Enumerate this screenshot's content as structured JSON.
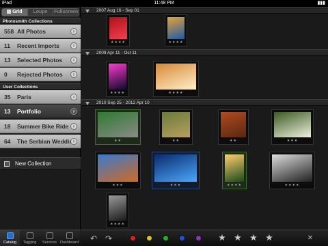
{
  "status_bar": {
    "device": "iPad",
    "wifi": "wifi",
    "time": "11:48 PM",
    "battery": "battery-full"
  },
  "view_switch": {
    "options": [
      "Grid",
      "Loupe",
      "Fullscreen"
    ],
    "selected": "Grid"
  },
  "sidebar": {
    "photosmith_header": "Photosmith Collections",
    "photosmith_items": [
      {
        "count": "558",
        "label": "All Photos"
      },
      {
        "count": "11",
        "label": "Recent Imports"
      },
      {
        "count": "13",
        "label": "Selected Photos"
      },
      {
        "count": "0",
        "label": "Rejected Photos"
      }
    ],
    "user_header": "User Collections",
    "user_items": [
      {
        "count": "35",
        "label": "Paris"
      },
      {
        "count": "13",
        "label": "Portfolio",
        "selected": true
      },
      {
        "count": "18",
        "label": "Summer Bike Ride"
      },
      {
        "count": "64",
        "label": "The Serbian Wedding"
      }
    ],
    "new_collection": "New Collection"
  },
  "sections": [
    {
      "title": "2007 Aug 16 - Sep 01"
    },
    {
      "title": "2009 Apr 11 - Oct 11"
    },
    {
      "title": "2010 Sep 25 - 2012 Apr 10"
    }
  ],
  "thumbs": [
    {
      "name": "photo-red-flowers",
      "stars": "★★★★",
      "colors": [
        "#b0101a",
        "#f04050"
      ]
    },
    {
      "name": "photo-lake-sky",
      "stars": "★★★★",
      "colors": [
        "#e6a23a",
        "#1d5aa8"
      ]
    },
    {
      "name": "photo-light-painting",
      "stars": "★★★★",
      "colors": [
        "#ff3ad1",
        "#0a0a28"
      ]
    },
    {
      "name": "photo-airplane",
      "stars": "★★★★",
      "colors": [
        "#d8883a",
        "#fff0c8"
      ]
    },
    {
      "name": "photo-green-car",
      "stars": "★★",
      "colors": [
        "#2f7a2f",
        "#8a8a8a"
      ]
    },
    {
      "name": "photo-field-birds",
      "stars": "★★",
      "colors": [
        "#6a7a3a",
        "#b8a060"
      ]
    },
    {
      "name": "photo-autumn-grass",
      "stars": "★★",
      "colors": [
        "#b04a20",
        "#5a2810"
      ]
    },
    {
      "name": "photo-white-flowers",
      "stars": "★★★",
      "colors": [
        "#3a5a20",
        "#f0f0e0"
      ]
    },
    {
      "name": "photo-motorcycle",
      "stars": "★★★",
      "colors": [
        "#3a7ad0",
        "#d06a20"
      ]
    },
    {
      "name": "photo-blue-light",
      "stars": "★★★",
      "colors": [
        "#0a2a6a",
        "#4aa8ff"
      ]
    },
    {
      "name": "photo-sunset-field",
      "stars": "★★★★",
      "colors": [
        "#ffd070",
        "#1a4a1a"
      ]
    },
    {
      "name": "photo-window-silhouette",
      "stars": "★★★★",
      "colors": [
        "#dddddd",
        "#202020"
      ]
    },
    {
      "name": "photo-tall-portrait",
      "stars": "★★★★",
      "colors": [
        "#9a9a9a",
        "#1a1a1a"
      ]
    }
  ],
  "tabs": [
    {
      "label": "Catalog",
      "selected": true
    },
    {
      "label": "Tagging"
    },
    {
      "label": "Services"
    },
    {
      "label": "Dashboard"
    }
  ],
  "toolbar": {
    "rotate_left": "↶",
    "rotate_right": "↷",
    "color_labels": [
      "#e02020",
      "#e0c020",
      "#20b020",
      "#2050e0",
      "#9030c0"
    ],
    "stars": [
      "★",
      "★",
      "★",
      "★"
    ],
    "reject": "✕"
  }
}
